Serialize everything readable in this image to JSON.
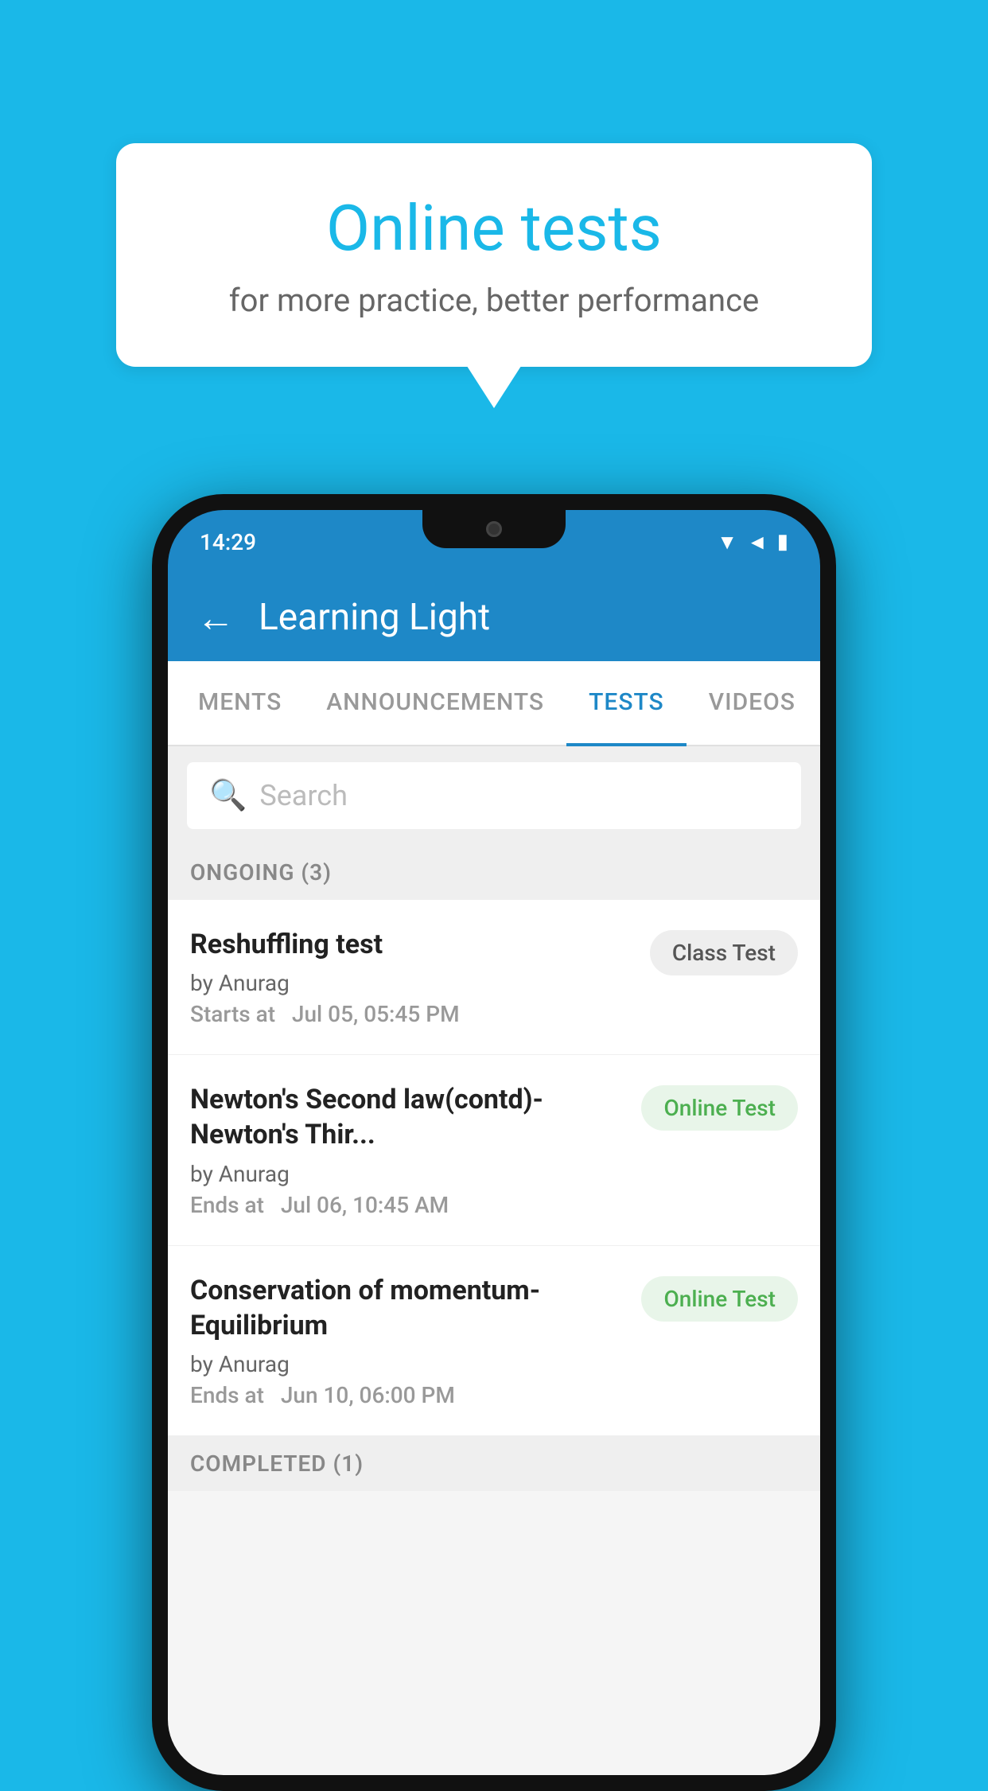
{
  "background_color": "#1ab8e8",
  "speech_bubble": {
    "title": "Online tests",
    "subtitle": "for more practice, better performance"
  },
  "phone": {
    "status_bar": {
      "time": "14:29",
      "icons": [
        "wifi",
        "signal",
        "battery"
      ]
    },
    "app_bar": {
      "back_label": "←",
      "title": "Learning Light"
    },
    "tabs": [
      {
        "label": "MENTS",
        "active": false
      },
      {
        "label": "ANNOUNCEMENTS",
        "active": false
      },
      {
        "label": "TESTS",
        "active": true
      },
      {
        "label": "VIDEOS",
        "active": false
      }
    ],
    "search": {
      "placeholder": "Search"
    },
    "section_ongoing": {
      "label": "ONGOING (3)"
    },
    "tests": [
      {
        "title": "Reshuffling test",
        "author": "by Anurag",
        "time_label": "Starts at",
        "time_value": "Jul 05, 05:45 PM",
        "badge": "Class Test",
        "badge_type": "class"
      },
      {
        "title": "Newton's Second law(contd)-Newton's Thir...",
        "author": "by Anurag",
        "time_label": "Ends at",
        "time_value": "Jul 06, 10:45 AM",
        "badge": "Online Test",
        "badge_type": "online"
      },
      {
        "title": "Conservation of momentum-Equilibrium",
        "author": "by Anurag",
        "time_label": "Ends at",
        "time_value": "Jun 10, 06:00 PM",
        "badge": "Online Test",
        "badge_type": "online"
      }
    ],
    "section_completed": {
      "label": "COMPLETED (1)"
    }
  }
}
